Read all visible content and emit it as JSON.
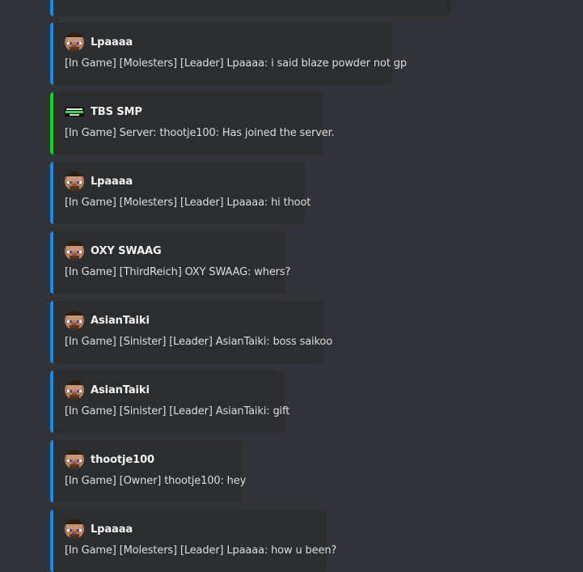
{
  "colors": {
    "background": "#313338",
    "embed_background": "#2b2d31",
    "player_accent": "#1e88e5",
    "server_accent": "#14d222"
  },
  "messages": [
    {
      "kind": "player",
      "author": "",
      "text": ""
    },
    {
      "kind": "player",
      "author": "Lpaaaa",
      "text": "[In Game] [Molesters] [Leader] Lpaaaa: i said blaze powder not gp"
    },
    {
      "kind": "server",
      "author": "TBS SMP",
      "text": "[In Game] Server: thootje100: Has joined the server."
    },
    {
      "kind": "player",
      "author": "Lpaaaa",
      "text": "[In Game] [Molesters] [Leader] Lpaaaa: hi thoot"
    },
    {
      "kind": "player",
      "author": "OXY SWAAG",
      "text": "[In Game] [ThirdReich] OXY SWAAG: whers?"
    },
    {
      "kind": "player",
      "author": "AsianTaiki",
      "text": "[In Game] [Sinister] [Leader] AsianTaiki: boss saikoo"
    },
    {
      "kind": "player",
      "author": "AsianTaiki",
      "text": "[In Game] [Sinister] [Leader] AsianTaiki: gift"
    },
    {
      "kind": "player",
      "author": "thootje100",
      "text": "[In Game] [Owner] thootje100: hey"
    },
    {
      "kind": "player",
      "author": "Lpaaaa",
      "text": "[In Game] [Molesters] [Leader] Lpaaaa: how u been?"
    }
  ]
}
